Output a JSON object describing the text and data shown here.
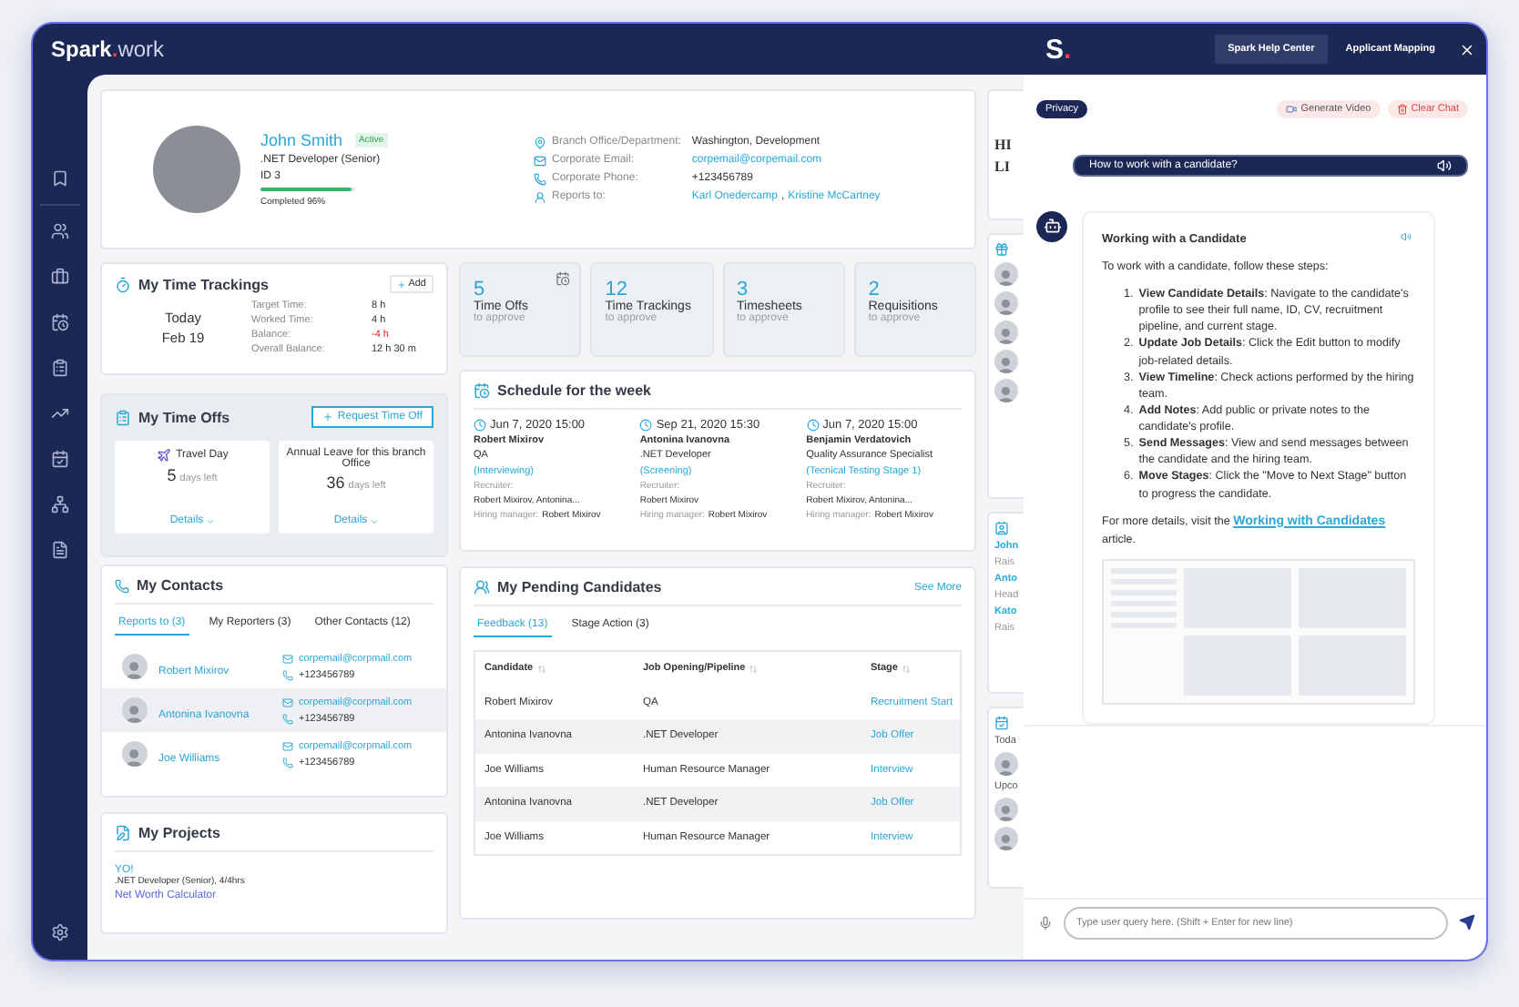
{
  "logo": {
    "name": "Spark",
    "dot": ".",
    "suffix": "work"
  },
  "profile": {
    "name": "John Smith",
    "status": "Active",
    "title": ".NET Developer (Senior)",
    "id": "ID 3",
    "completion": {
      "level": 0.96,
      "label": "Completed 96%"
    },
    "fields": [
      {
        "kind": "location",
        "label": "Branch Office/Department:",
        "values": [
          {
            "text": "Washington, Development",
            "link": false
          }
        ]
      },
      {
        "kind": "email",
        "label": "Corporate Email:",
        "values": [
          {
            "text": "corpemail@corpemail.com",
            "link": true
          }
        ]
      },
      {
        "kind": "phone",
        "label": "Corporate Phone:",
        "values": [
          {
            "text": "+123456789",
            "link": false
          }
        ]
      },
      {
        "kind": "person",
        "label": "Reports to:",
        "values": [
          {
            "text": "Karl Onedercamp",
            "link": true
          },
          {
            "text": ",",
            "link": false
          },
          {
            "text": "Kristine McCartney",
            "link": true
          }
        ]
      }
    ]
  },
  "time_trackings": {
    "title": "My Time Trackings",
    "add": "Add",
    "day": "Today",
    "date": "Feb 19",
    "rows": [
      {
        "label": "Target Time:",
        "value": "8 h",
        "negative": false
      },
      {
        "label": "Worked Time:",
        "value": "4 h",
        "negative": false
      },
      {
        "label": "Balance:",
        "value": "-4 h",
        "negative": true
      },
      {
        "label": "Overall Balance:",
        "value": "12 h 30 m",
        "negative": false
      }
    ]
  },
  "stats": [
    {
      "count": "5",
      "label": "Time Offs",
      "sub": "to approve",
      "icon": true
    },
    {
      "count": "12",
      "label": "Time Trackings",
      "sub": "to approve",
      "icon": false
    },
    {
      "count": "3",
      "label": "Timesheets",
      "sub": "to approve",
      "icon": false
    },
    {
      "count": "2",
      "label": "Requisitions",
      "sub": "to approve",
      "icon": false
    }
  ],
  "time_offs": {
    "title": "My Time Offs",
    "button": "Request Time Off",
    "cards": [
      {
        "kind": "travel",
        "title": "Travel Day",
        "count": "5",
        "unit": "days left",
        "link": "Details"
      },
      {
        "kind": "plain",
        "title": "Annual Leave for this branch Office",
        "count": "36",
        "unit": "days left",
        "link": "Details"
      }
    ]
  },
  "schedule": {
    "title": "Schedule for the week",
    "items": [
      {
        "datetime": "Jun 7, 2020 15:00",
        "name": "Robert Mixirov",
        "job": "QA",
        "stage": "(Interviewing)",
        "recruiter_label": "Recruiter:",
        "recruiter": "Robert Mixirov, Antonina...",
        "manager_label": "Hiring manager:",
        "manager": "Robert Mixirov"
      },
      {
        "datetime": "Sep 21, 2020 15:30",
        "name": "Antonina Ivanovna",
        "job": ".NET Developer",
        "stage": "(Screening)",
        "recruiter_label": "Recruiter:",
        "recruiter": "Robert Mixirov",
        "manager_label": "Hiring manager:",
        "manager": "Robert Mixirov"
      },
      {
        "datetime": "Jun 7, 2020 15:00",
        "name": "Benjamin Verdatovich",
        "job": "Quality Assurance Specialist",
        "stage": "(Tecnical Testing Stage 1)",
        "recruiter_label": "Recruiter:",
        "recruiter": "Robert Mixirov, Antonina...",
        "manager_label": "Hiring manager:",
        "manager": "Robert Mixirov"
      }
    ]
  },
  "contacts": {
    "title": "My Contacts",
    "tabs": [
      {
        "label": "Reports to (3)",
        "selected": true
      },
      {
        "label": "My Reporters (3)",
        "selected": false
      },
      {
        "label": "Other Contacts (12)",
        "selected": false
      }
    ],
    "rows": [
      {
        "name": "Robert Mixirov",
        "email": "corpemail@corpmail.com",
        "phone": "+123456789",
        "highlighted": false
      },
      {
        "name": "Antonina Ivanovna",
        "email": "corpemail@corpmail.com",
        "phone": "+123456789",
        "highlighted": true
      },
      {
        "name": "Joe Williams",
        "email": "corpemail@corpmail.com",
        "phone": "+123456789",
        "highlighted": false
      }
    ]
  },
  "projects": {
    "title": "My Projects",
    "items": [
      {
        "name": "YO!",
        "detail": ".NET Developer (Senior), 4/4hrs"
      },
      {
        "name": "Net Worth Calculator"
      }
    ]
  },
  "candidates": {
    "title": "My Pending Candidates",
    "more": "See More",
    "tabs": [
      {
        "label": "Feedback (13)",
        "selected": true
      },
      {
        "label": "Stage Action (3)",
        "selected": false
      }
    ],
    "columns": [
      "Candidate",
      "Job Opening/Pipeline",
      "Stage"
    ],
    "rows": [
      {
        "candidate": "Robert Mixirov",
        "job": "QA",
        "stage": "Recruitment Start"
      },
      {
        "candidate": "Antonina Ivanovna",
        "job": ".NET Developer",
        "stage": "Job Offer"
      },
      {
        "candidate": "Joe Williams",
        "job": "Human Resource Manager",
        "stage": "Interview"
      },
      {
        "candidate": "Antonina Ivanovna",
        "job": ".NET Developer",
        "stage": "Job Offer"
      },
      {
        "candidate": "Joe Williams",
        "job": "Human Resource Manager",
        "stage": "Interview"
      }
    ]
  },
  "strip": {
    "cards": [
      {
        "kind": "logo",
        "texts": [
          "HI",
          "LI"
        ]
      },
      {
        "kind": "gift"
      },
      {
        "kind": "people",
        "texts": [
          "John",
          "Rais",
          "Anto",
          "Head",
          "Kato",
          "Rais"
        ]
      },
      {
        "kind": "calendar",
        "texts": [
          "Toda",
          "Upco"
        ]
      }
    ]
  },
  "chat": {
    "logo": {
      "letter": "S",
      "dot": "."
    },
    "tabs": [
      {
        "label": "Spark Help Center",
        "selected": true
      },
      {
        "label": "Applicant Mapping",
        "selected": false
      }
    ],
    "privacy": "Privacy",
    "actions": [
      {
        "kind": "video",
        "label": "Generate Video"
      },
      {
        "kind": "clear",
        "label": "Clear Chat"
      }
    ],
    "question": "How to work with a candidate?",
    "answer": {
      "title": "Working with a Candidate",
      "intro": "To work with a candidate, follow these steps:",
      "steps": [
        {
          "number": "1.",
          "text": "**View Candidate Details**: Navigate to the candidate's profile to see their full name, ID, CV, recruitment pipeline, and current stage."
        },
        {
          "number": "2.",
          "text": "**Update Job Details**: Click the Edit button to modify job-related details."
        },
        {
          "number": "3.",
          "text": "**View Timeline**: Check actions performed by the hiring team."
        },
        {
          "number": "4.",
          "text": "**Add Notes**: Add public or private notes to the candidate's profile."
        },
        {
          "number": "5.",
          "text": "**Send Messages**: View and send messages between the candidate and the hiring team."
        },
        {
          "number": "6.",
          "text": "**Move Stages**: Click the \"Move to Next Stage\" button to progress the candidate."
        }
      ],
      "outro_before": "For more details, visit the",
      "link": "Working with Candidates",
      "outro_after": "article."
    },
    "input": {
      "placeholder": "Type user query here. (Shift + Enter for new line)"
    }
  }
}
